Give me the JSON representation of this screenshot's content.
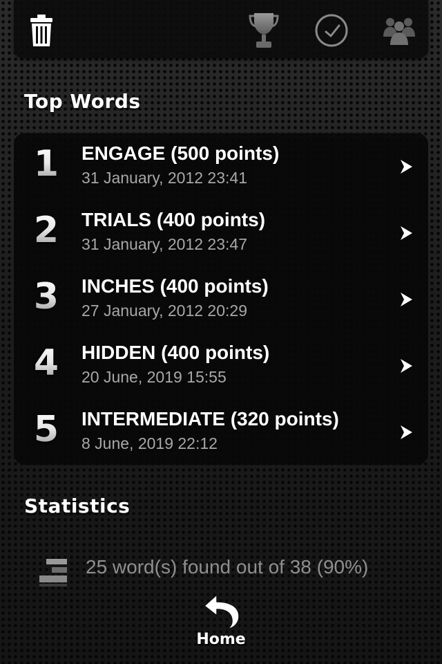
{
  "toolbar": {
    "buttons": [
      {
        "icon": "trash-icon"
      },
      {
        "icon": "trophy-icon"
      },
      {
        "icon": "clock-icon"
      },
      {
        "icon": "people-icon"
      }
    ]
  },
  "top_words": {
    "title": "Top Words",
    "rows": [
      {
        "rank": "1",
        "word": "ENGAGE (500 points)",
        "date": "31 January, 2012 23:41"
      },
      {
        "rank": "2",
        "word": "TRIALS (400 points)",
        "date": "31 January, 2012 23:47"
      },
      {
        "rank": "3",
        "word": "INCHES (400 points)",
        "date": "27 January, 2012 20:29"
      },
      {
        "rank": "4",
        "word": "HIDDEN (400 points)",
        "date": "20 June, 2019 15:55"
      },
      {
        "rank": "5",
        "word": "INTERMEDIATE (320 points)",
        "date": "8 June, 2019 22:12"
      }
    ]
  },
  "statistics": {
    "title": "Statistics",
    "items": [
      {
        "icon": "bar-chart-icon",
        "text": "25 word(s) found out of 38 (90%)"
      }
    ]
  },
  "home": {
    "label": "Home",
    "icon": "back-arrow-icon"
  }
}
